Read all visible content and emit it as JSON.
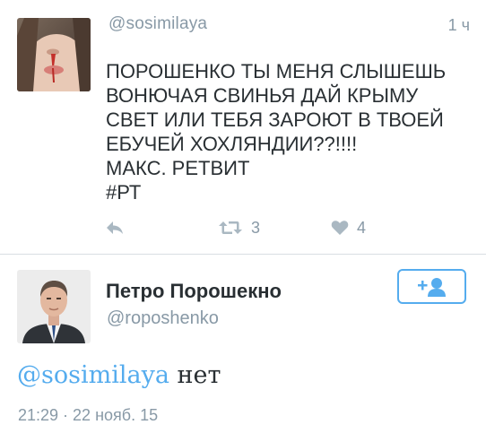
{
  "tweet1": {
    "handle": "@sosimilaya",
    "time": "1 ч",
    "text_lines": [
      "ПОРОШЕНКО ТЫ МЕНЯ СЛЫШЕШЬ",
      "ВОНЮЧАЯ СВИНЬЯ ДАЙ КРЫМУ",
      "СВЕТ ИЛИ ТЕБЯ ЗАРОЮТ В ТВОЕЙ",
      "ЕБУЧЕЙ ХОХЛЯНДИИ??!!!!",
      "МАКС. РЕТВИТ",
      "#РТ"
    ],
    "retweet_count": "3",
    "like_count": "4"
  },
  "tweet2": {
    "display_name": "Петро Порошекно",
    "handle": "@roposhenko",
    "reply_mention": "@sosimilaya",
    "reply_text": " нет",
    "timestamp": "21:29 · 22 нояб. 15"
  },
  "icons": {
    "reply": "reply-arrow-icon",
    "retweet": "retweet-icon",
    "like": "heart-icon",
    "follow": "add-user-icon"
  },
  "colors": {
    "accent": "#55acee",
    "muted": "#8899a6",
    "text": "#292f33",
    "divider": "#d8dee3",
    "icon": "#aab8c2"
  }
}
